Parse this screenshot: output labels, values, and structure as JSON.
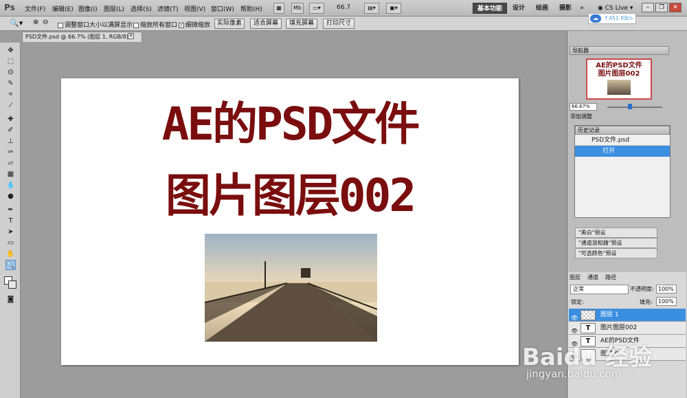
{
  "app": {
    "logo": "Ps"
  },
  "menu": [
    "文件(F)",
    "编辑(E)",
    "图像(I)",
    "图层(L)",
    "选择(S)",
    "滤镜(T)",
    "视图(V)",
    "窗口(W)",
    "帮助(H)"
  ],
  "zoom_value": "66.7",
  "workspaces": {
    "basic": "基本功能",
    "design": "设计",
    "paint": "绘画",
    "photo": "摄影",
    "more": "»"
  },
  "cslive": "CS Live",
  "speed": "451 KB/s",
  "options": {
    "resize_window": "调整窗口大小以满屏显示",
    "zoom_all": "缩放所有窗口",
    "scrubby": "细微缩放",
    "actual_pixels": "实际像素",
    "fit_screen": "适合屏幕",
    "fill_screen": "填充屏幕",
    "print_size": "打印尺寸"
  },
  "document": {
    "tab": "PSD文件.psd @ 66.7% (图层 1, RGB/8)",
    "line1": "AE的PSD文件",
    "line2": "图片图层002"
  },
  "navigator": {
    "title": "导航器",
    "zoom": "66.67%",
    "thumb1": "AE的PSD文件",
    "thumb2": "图片图层002"
  },
  "adjustments": {
    "title": "添加调整"
  },
  "history": {
    "title": "历史记录",
    "snapshot": "PSD文件.psd",
    "step": "打开"
  },
  "presets": [
    "\"黑白\"预设",
    "\"通道混和器\"预设",
    "\"可选颜色\"预设"
  ],
  "layers_panel": {
    "tabs": [
      "图层",
      "通道",
      "路径"
    ],
    "blend": "正常",
    "opacity_label": "不透明度:",
    "opacity": "100%",
    "lock_label": "锁定:",
    "fill_label": "填充:",
    "fill": "100%",
    "layers": [
      "图层 1",
      "图片图层002",
      "AE的PSD文件",
      "图层 0"
    ]
  },
  "watermark": {
    "line1": "Baidu 经验",
    "line2": "jingyan.baidu.com"
  },
  "colors": {
    "accent": "#3b8fe0",
    "text_red": "#7a0e0e"
  }
}
